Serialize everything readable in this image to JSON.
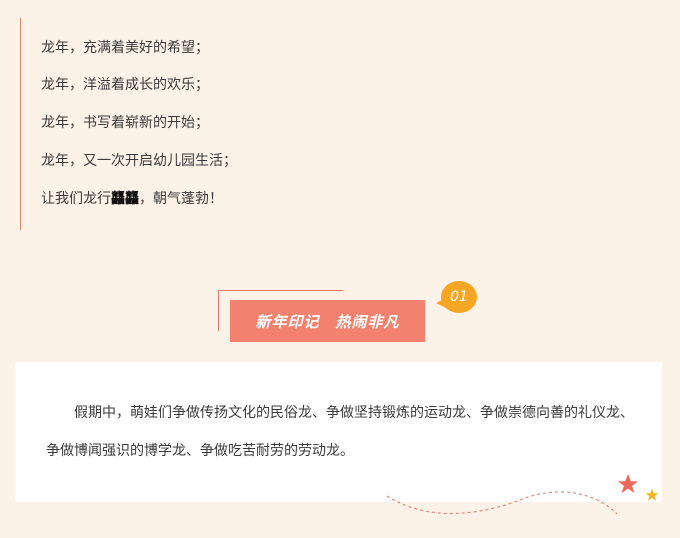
{
  "poem": {
    "lines": [
      "龙年，充满着美好的希望；",
      "龙年，洋溢着成长的欢乐；",
      "龙年，书写着崭新的开始；",
      "龙年，又一次开启幼儿园生活；"
    ],
    "last_line_prefix": "让我们龙行",
    "last_line_emph": "龘龘",
    "last_line_suffix": "，朝气蓬勃！"
  },
  "section": {
    "number": "01",
    "title": "新年印记　热闹非凡"
  },
  "card": {
    "paragraph": "假期中，萌娃们争做传扬文化的民俗龙、争做坚持锻炼的运动龙、争做崇德向善的礼仪龙、争做博闻强识的博学龙、争做吃苦耐劳的劳动龙。"
  },
  "colors": {
    "background": "#fdf2e8",
    "accent": "#f2826f",
    "badge": "#f5a623",
    "line": "#d98a6e"
  },
  "icons": [
    "red-star-icon",
    "yellow-star-icon"
  ]
}
